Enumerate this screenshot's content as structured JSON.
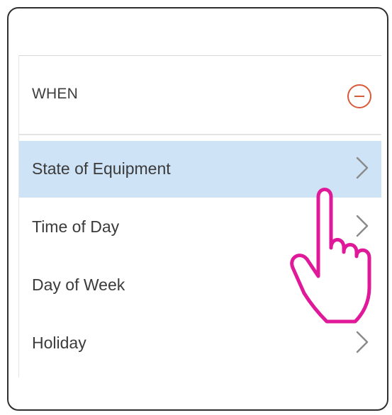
{
  "section": {
    "title": "WHEN",
    "remove_icon": "minus-circle-icon"
  },
  "menu": {
    "items": [
      {
        "label": "State of Equipment",
        "selected": true,
        "chevron": true
      },
      {
        "label": "Time of Day",
        "selected": false,
        "chevron": true
      },
      {
        "label": "Day of Week",
        "selected": false,
        "chevron": false
      },
      {
        "label": "Holiday",
        "selected": false,
        "chevron": true
      }
    ]
  },
  "colors": {
    "selected_row": "#cfe3f6",
    "remove_accent": "#d85a3a",
    "pointer_outline": "#e0189a",
    "chevron": "#8a8a8a"
  },
  "pointer": {
    "icon": "hand-pointer-icon"
  }
}
